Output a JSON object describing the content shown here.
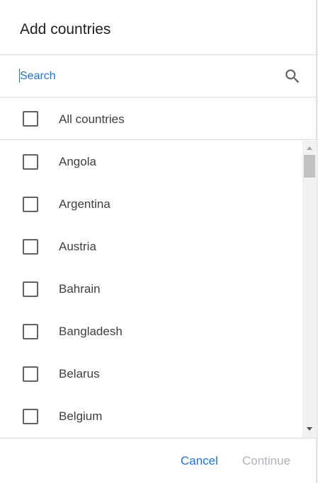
{
  "dialog": {
    "title": "Add countries"
  },
  "search": {
    "placeholder": "Search",
    "value": ""
  },
  "all_option": {
    "label": "All countries",
    "checked": false
  },
  "countries": [
    {
      "label": "Angola",
      "checked": false
    },
    {
      "label": "Argentina",
      "checked": false
    },
    {
      "label": "Austria",
      "checked": false
    },
    {
      "label": "Bahrain",
      "checked": false
    },
    {
      "label": "Bangladesh",
      "checked": false
    },
    {
      "label": "Belarus",
      "checked": false
    },
    {
      "label": "Belgium",
      "checked": false
    }
  ],
  "footer": {
    "cancel_label": "Cancel",
    "continue_label": "Continue",
    "continue_enabled": false
  },
  "icons": {
    "search": "search-icon",
    "checkbox": "checkbox-empty"
  },
  "colors": {
    "accent": "#1a73e8",
    "text": "#3c4043",
    "title": "#202124",
    "disabled": "#aeb2b6",
    "divider": "#dadce0",
    "checkbox_border": "#5f6368"
  }
}
